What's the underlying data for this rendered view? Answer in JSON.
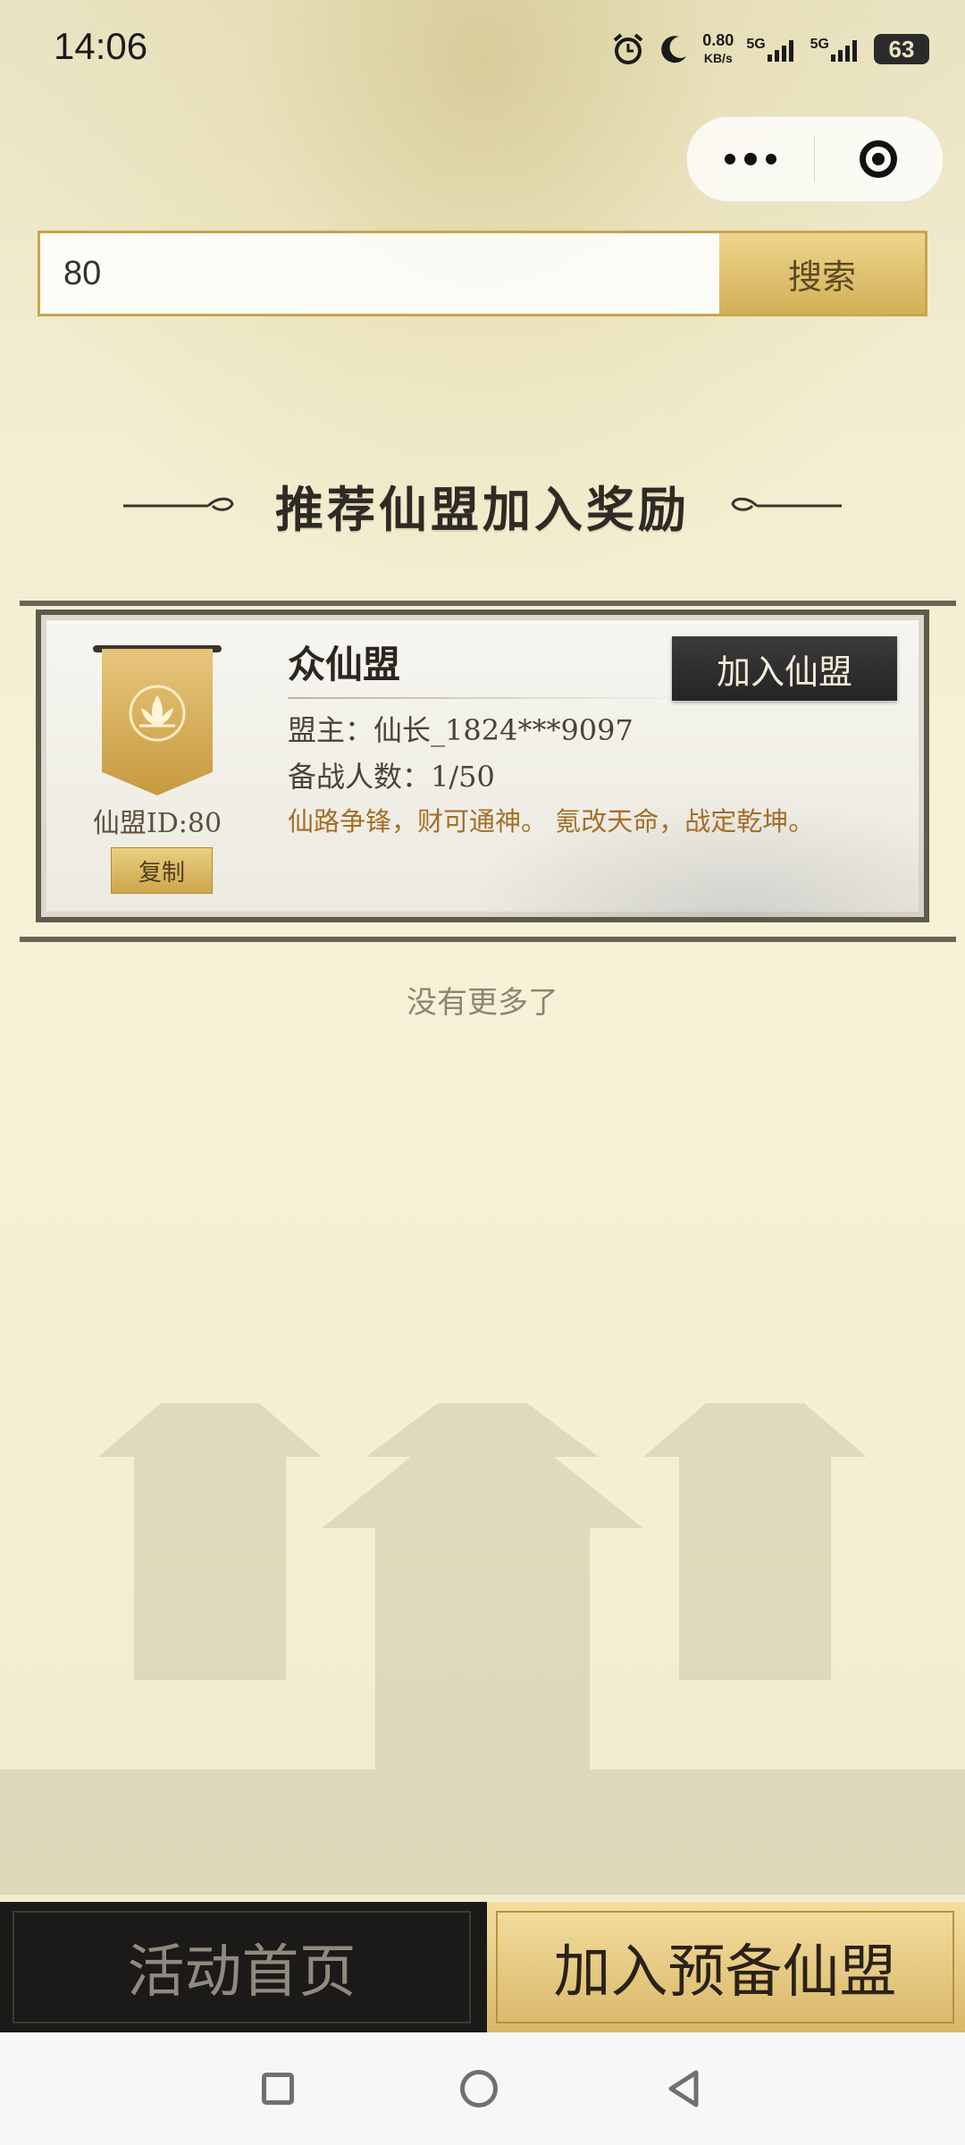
{
  "status_bar": {
    "time": "14:06",
    "net_speed_value": "0.80",
    "net_speed_unit": "KB/s",
    "signal1_label": "5G",
    "signal2_label": "5G",
    "battery": "63"
  },
  "search": {
    "value": "80",
    "button_label": "搜索"
  },
  "section": {
    "title": "推荐仙盟加入奖励"
  },
  "guild_card": {
    "name": "众仙盟",
    "join_label": "加入仙盟",
    "leader": "盟主：仙长_1824***9097",
    "members": "备战人数：1/50",
    "motto": "仙路争锋，财可通神。 氪改天命，战定乾坤。",
    "id_label": "仙盟ID:80",
    "copy_label": "复制"
  },
  "list_footer": "没有更多了",
  "bottom_actions": {
    "home_label": "活动首页",
    "join_reserve_label": "加入预备仙盟"
  },
  "colors": {
    "accent_gold": "#d3b057",
    "dark_button": "#252424",
    "motto_text": "#a56e25"
  }
}
